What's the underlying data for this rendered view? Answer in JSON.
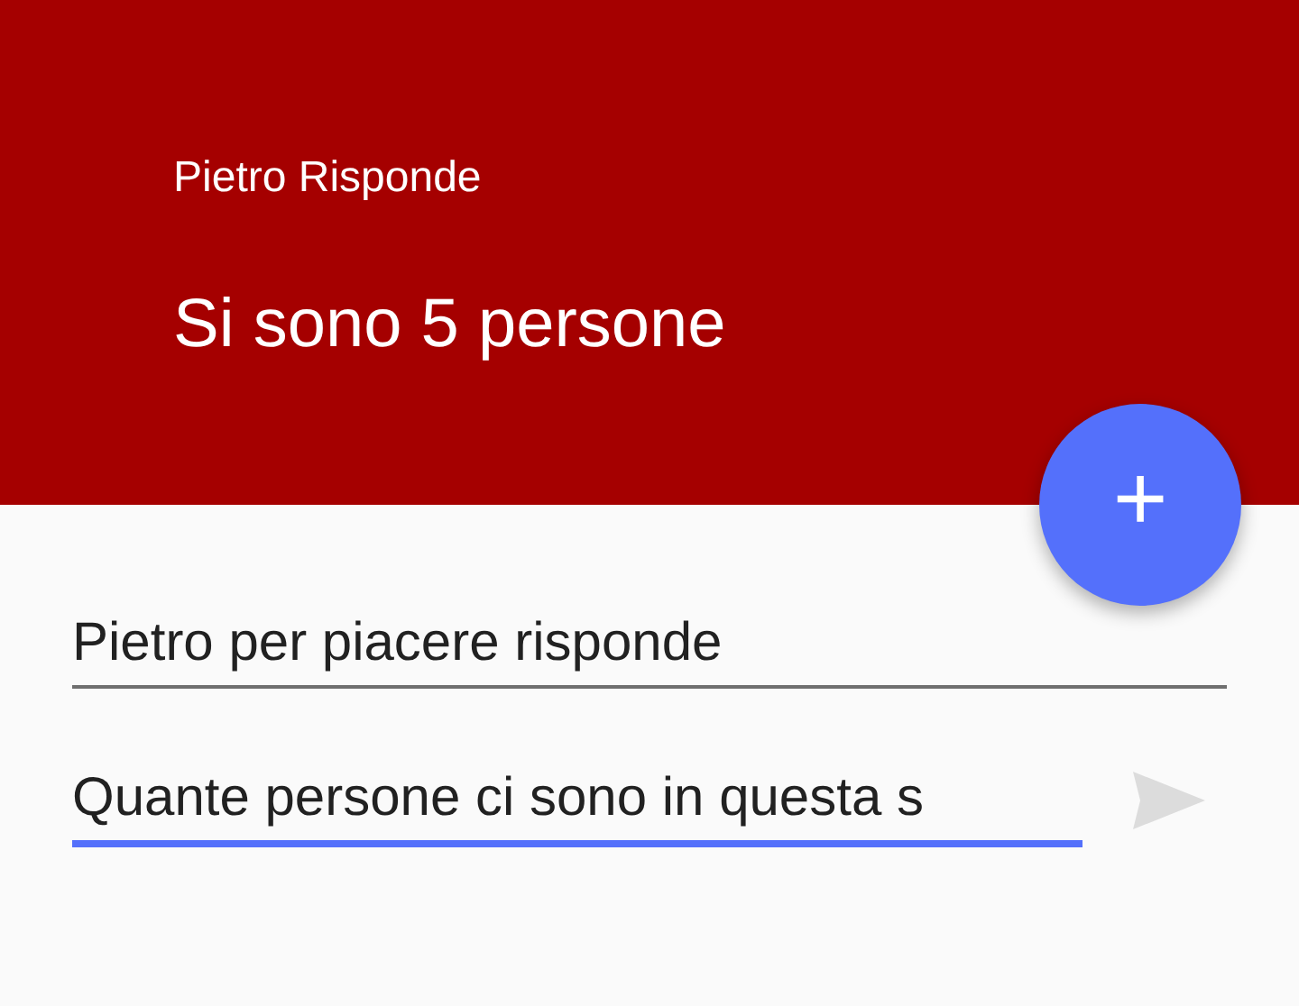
{
  "header": {
    "subtitle": "Pietro Risponde",
    "title": "Si sono 5 persone"
  },
  "fab": {
    "label": "+"
  },
  "fields": [
    {
      "value": "Pietro per piacere risponde",
      "focused": false
    },
    {
      "value": "Quante persone ci sono in questa s",
      "focused": true
    }
  ],
  "send_button": {
    "disabled": true
  }
}
